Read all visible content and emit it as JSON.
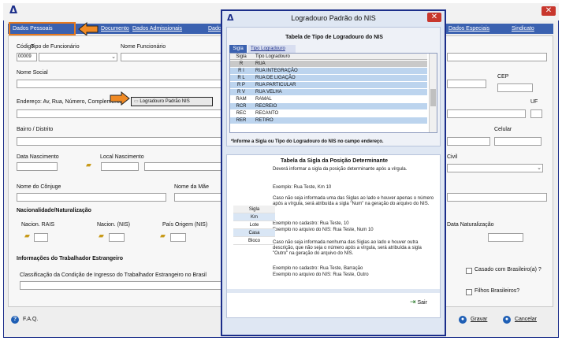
{
  "app": {
    "logo": "Δ",
    "close": "✕"
  },
  "tabs": [
    {
      "label": "Dados Pessoais"
    },
    {
      "label": "Documentos"
    },
    {
      "label": "Dados Admissionais"
    },
    {
      "label": "Dados"
    },
    {
      "label": "Dados Especiais"
    },
    {
      "label": "Sindicato"
    }
  ],
  "form": {
    "codigo_label": "Código",
    "tipo_funcionario_label": "Tipo de Funcionário",
    "codigo_value": "00009",
    "nome_funcionario_label": "Nome Funcionário",
    "nome_social_label": "Nome Social",
    "cep_label": "CEP",
    "endereco_label": "Endereço: Av, Rua, Número, Complemento",
    "logradouro_button": "Logradouro Padrão NIS",
    "uf_label": "UF",
    "bairro_label": "Bairro / Distrito",
    "celular_label": "Celular",
    "data_nascimento_label": "Data Nascimento",
    "local_nascimento_label": "Local Nascimento",
    "civil_label": "Civil",
    "conjuge_label": "Nome do Cônjuge",
    "mae_label": "Nome da Mãe",
    "nacionalidade_header": "Nacionalidade/Naturalização",
    "nacion_rais_label": "Nacion. RAIS",
    "nacion_nis_label": "Nacion. (NIS)",
    "pais_origem_label": "País Origem (NIS)",
    "data_naturalizacao_label": "Data Naturalização",
    "estrangeiro_header": "Informações do Trabalhador Estrangeiro",
    "classificacao_label": "Classificação da Condição de Ingresso do Trabalhador Estrangeiro no Brasil",
    "casado_label": "Casado com Brasileiro(a) ?",
    "filhos_label": "Filhos Brasileiros?"
  },
  "footer": {
    "faq": "F.A.Q.",
    "gravar": "Gravar",
    "cancelar": "Cancelar"
  },
  "modal": {
    "title": "Logradouro Padrão do NIS",
    "table_title": "Tabela de Tipo de Logradouro do NIS",
    "tab_sigla": "Sigla",
    "tab_tipo": "Tipo Logradouro",
    "col_sigla": "Sigla",
    "col_tipo": "Tipo Logradouro",
    "rows": [
      {
        "sigla": "R",
        "tipo": "RUA"
      },
      {
        "sigla": "R I",
        "tipo": "RUA INTEGRAÇÃO"
      },
      {
        "sigla": "R L",
        "tipo": "RUA DE LIGAÇÃO"
      },
      {
        "sigla": "R P",
        "tipo": "RUA PARTICULAR"
      },
      {
        "sigla": "R V",
        "tipo": "RUA VELHA"
      },
      {
        "sigla": "RAM",
        "tipo": "RAMAL"
      },
      {
        "sigla": "RCR",
        "tipo": "RECREIO"
      },
      {
        "sigla": "REC",
        "tipo": "RECANTO"
      },
      {
        "sigla": "RER",
        "tipo": "RETIRO"
      }
    ],
    "info_note": "*Informe a Sigla ou Tipo do Logradouro do NIS no campo endereço.",
    "sec2_title": "Tabela da Sigla da Posição Determinante",
    "p1": "Deverá informar a sigla da posição determinante após a vírgula.",
    "p2": "Exemplo: Rua Teste, Km 10",
    "p3": "Caso não seja informada uma das Siglas ao lado e houver apenas o número após a vírgula, será atribuída a sigla \"Num\" na geração do arquivo do NIS.",
    "p4a": "Exemplo no cadastro: Rua Teste, 10",
    "p4b": "Exemplo no arquivo do NIS: Rua Teste, Num 10",
    "p5": "Caso não seja informada nenhuma das Siglas ao lado e houver outra descrição, que não seja o número após a vírgula, será atribuída a sigla \"Outro\" na geração do arquivo do NIS.",
    "p6a": "Exemplo no cadastro: Rua Teste, Barração",
    "p6b": "Exemplo no arquivo do NIS: Rua Teste, Outro",
    "sig_header": "Sigla",
    "sig_items": [
      "Km",
      "Lote",
      "Casa",
      "Bloco"
    ],
    "sair": "Sair"
  },
  "colors": {
    "accent": "#3a61b0",
    "highlight": "#e87a1e",
    "border": "#1b2e8a"
  },
  "icons": [
    "folder-icon",
    "help-icon",
    "save-icon",
    "cancel-icon",
    "exit-icon",
    "arrow-icon"
  ]
}
